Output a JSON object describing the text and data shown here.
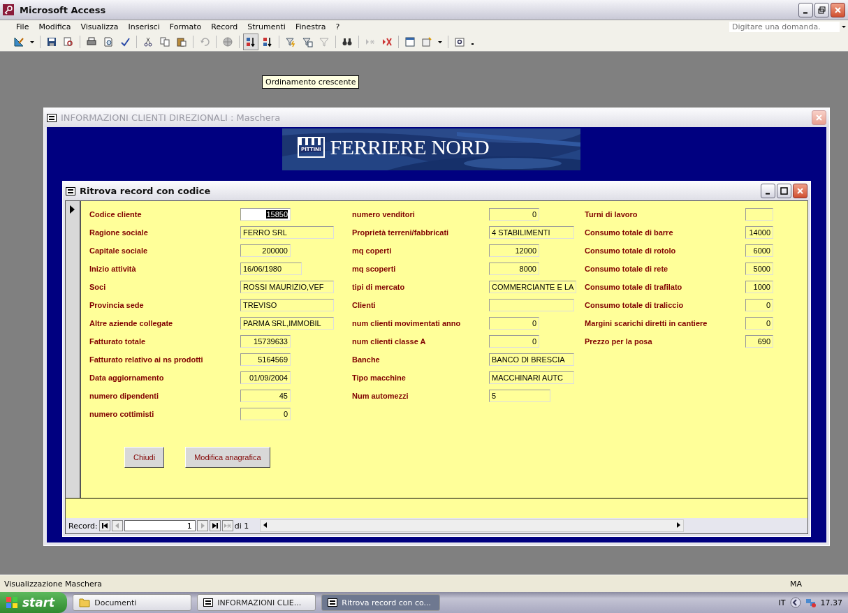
{
  "app": {
    "title": "Microsoft Access"
  },
  "menu": [
    {
      "label": "File"
    },
    {
      "label": "Modifica"
    },
    {
      "label": "Visualizza"
    },
    {
      "label": "Inserisci"
    },
    {
      "label": "Formato"
    },
    {
      "label": "Record"
    },
    {
      "label": "Strumenti"
    },
    {
      "label": "Finestra"
    },
    {
      "label": "?"
    }
  ],
  "help_box": {
    "placeholder": "Digitare una domanda."
  },
  "tooltip": "Ordinamento crescente",
  "outer_window": {
    "title": "INFORMAZIONI CLIENTI DIREZIONALI : Maschera",
    "logo_badge": "PITTINI",
    "logo_name": "FERRIERE NORD"
  },
  "inner_window": {
    "title": "Ritrova record con codice"
  },
  "columns": [
    [
      {
        "label": "Codice cliente",
        "value": "15850",
        "kind": "number",
        "selected": true
      },
      {
        "label": "Ragione sociale",
        "value": "FERRO SRL",
        "kind": "text",
        "selected": false
      },
      {
        "label": "Capitale sociale",
        "value": "200000",
        "kind": "number",
        "selected": false
      },
      {
        "label": "Inizio attività",
        "value": "16/06/1980",
        "kind": "date",
        "selected": false
      },
      {
        "label": "Soci",
        "value": "ROSSI MAURIZIO,VEF",
        "kind": "text",
        "selected": false
      },
      {
        "label": "Provincia sede",
        "value": "TREVISO",
        "kind": "text",
        "selected": false
      },
      {
        "label": "Altre aziende collegate",
        "value": "PARMA SRL,IMMOBIL",
        "kind": "text",
        "selected": false
      },
      {
        "label": "Fatturato totale",
        "value": "15739633",
        "kind": "number",
        "selected": false
      },
      {
        "label": "Fatturato relativo ai ns prodotti",
        "value": "5164569",
        "kind": "number",
        "selected": false
      },
      {
        "label": "Data aggiornamento",
        "value": "01/09/2004",
        "kind": "number",
        "selected": false
      },
      {
        "label": "numero dipendenti",
        "value": "45",
        "kind": "number",
        "selected": false
      },
      {
        "label": "numero cottimisti",
        "value": "0",
        "kind": "number",
        "selected": false
      }
    ],
    [
      {
        "label": "numero venditori",
        "value": "0",
        "kind": "number",
        "selected": false
      },
      {
        "label": "Proprietà terreni/fabbricati",
        "value": "4 STABILIMENTI",
        "kind": "text",
        "selected": false
      },
      {
        "label": "mq coperti",
        "value": "12000",
        "kind": "number",
        "selected": false
      },
      {
        "label": "mq scoperti",
        "value": "8000",
        "kind": "number",
        "selected": false
      },
      {
        "label": "tipi di mercato",
        "value": "COMMERCIANTE E LA",
        "kind": "text",
        "selected": false
      },
      {
        "label": "Clienti",
        "kind": "text",
        "selected": false
      },
      {
        "label": "num clienti movimentati anno",
        "value": "0",
        "kind": "number",
        "selected": false
      },
      {
        "label": "num clienti classe A",
        "value": "0",
        "kind": "number",
        "selected": false
      },
      {
        "label": "Banche",
        "value": "BANCO DI BRESCIA",
        "kind": "text",
        "selected": false
      },
      {
        "label": "Tipo macchine",
        "value": "MACCHINARI AUTC",
        "kind": "text",
        "selected": false
      },
      {
        "label": "Num automezzi",
        "value": "5",
        "kind": "date",
        "selected": false
      }
    ],
    [
      {
        "label": "Turni di lavoro",
        "kind": "number",
        "selected": false
      },
      {
        "label": "Consumo totale di barre",
        "value": "14000",
        "kind": "number",
        "selected": false
      },
      {
        "label": "Consumo totale di rotolo",
        "value": "6000",
        "kind": "number",
        "selected": false
      },
      {
        "label": "Consumo totale di rete",
        "value": "5000",
        "kind": "number",
        "selected": false
      },
      {
        "label": "Consumo totale di trafilato",
        "value": "1000",
        "kind": "number",
        "selected": false
      },
      {
        "label": "Consumo totale di traliccio",
        "value": "0",
        "kind": "number",
        "selected": false
      },
      {
        "label": "Margini scarichi diretti in cantiere",
        "value": "0",
        "kind": "number",
        "selected": false
      },
      {
        "label": "Prezzo per la posa",
        "value": "690",
        "kind": "number",
        "selected": false
      }
    ]
  ],
  "buttons": [
    "Chiudi",
    "Modifica anagrafica"
  ],
  "navigation": {
    "label": "Record:",
    "value": "1",
    "total": "di 1"
  },
  "status_bar": {
    "text": "Visualizzazione Maschera",
    "mode": "MA"
  },
  "taskbar": {
    "start": "start",
    "tasks": [
      {
        "label": "Documenti",
        "kind": "folder",
        "selected": false
      },
      {
        "label": "INFORMAZIONI CLIE...",
        "kind": "form",
        "selected": false
      },
      {
        "label": "Ritrova record con co...",
        "kind": "form",
        "selected": true
      }
    ],
    "language": "IT",
    "clock": "17.37"
  }
}
